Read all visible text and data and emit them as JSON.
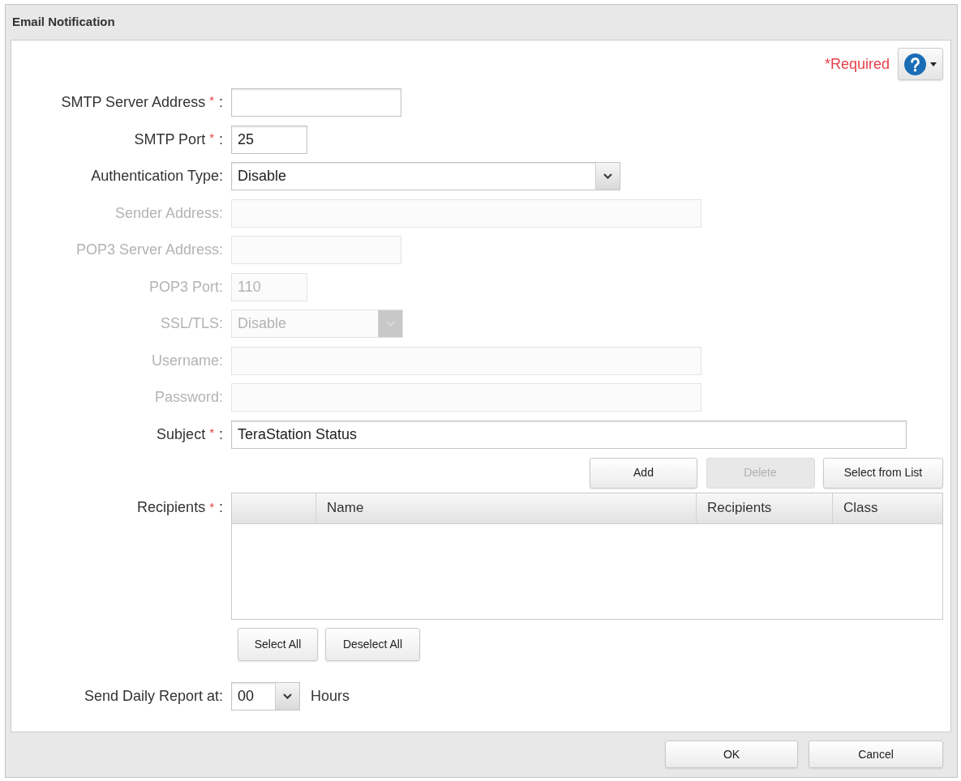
{
  "dialog": {
    "title": "Email Notification"
  },
  "required_note": "*Required",
  "fields": [
    {
      "kind": "text",
      "label": "SMTP Server Address",
      "required_mark": "*",
      "suffix": ":",
      "disabled": false
    },
    {
      "kind": "text",
      "label": "SMTP Port",
      "required_mark": "*",
      "suffix": ":",
      "value": "25",
      "disabled": false
    },
    {
      "kind": "select",
      "label": "Authentication Type:",
      "value": "Disable",
      "disabled": false
    },
    {
      "kind": "text",
      "label": "Sender Address:",
      "disabled": true
    },
    {
      "kind": "text",
      "label": "POP3 Server Address:",
      "disabled": true
    },
    {
      "kind": "text",
      "label": "POP3 Port:",
      "value": "110",
      "disabled": true
    },
    {
      "kind": "select",
      "label": "SSL/TLS:",
      "value": "Disable",
      "disabled": true
    },
    {
      "kind": "text",
      "label": "Username:",
      "disabled": true
    },
    {
      "kind": "text",
      "label": "Password:",
      "disabled": true
    },
    {
      "kind": "text",
      "label": "Subject",
      "required_mark": "*",
      "suffix": ":",
      "value": "TeraStation Status",
      "disabled": false
    }
  ],
  "recipients": {
    "label": "Recipients",
    "required_mark": "*",
    "suffix": ":",
    "buttons": [
      {
        "label": "Add",
        "disabled": false
      },
      {
        "label": "Delete",
        "disabled": true
      },
      {
        "label": "Select from List",
        "disabled": false
      }
    ],
    "columns": [
      "Name",
      "Recipients",
      "Class"
    ],
    "selection_buttons": [
      "Select All",
      "Deselect All"
    ]
  },
  "daily_report": {
    "label": "Send Daily Report at:",
    "value": "00",
    "unit": "Hours"
  },
  "footer_buttons": [
    "OK",
    "Cancel"
  ]
}
